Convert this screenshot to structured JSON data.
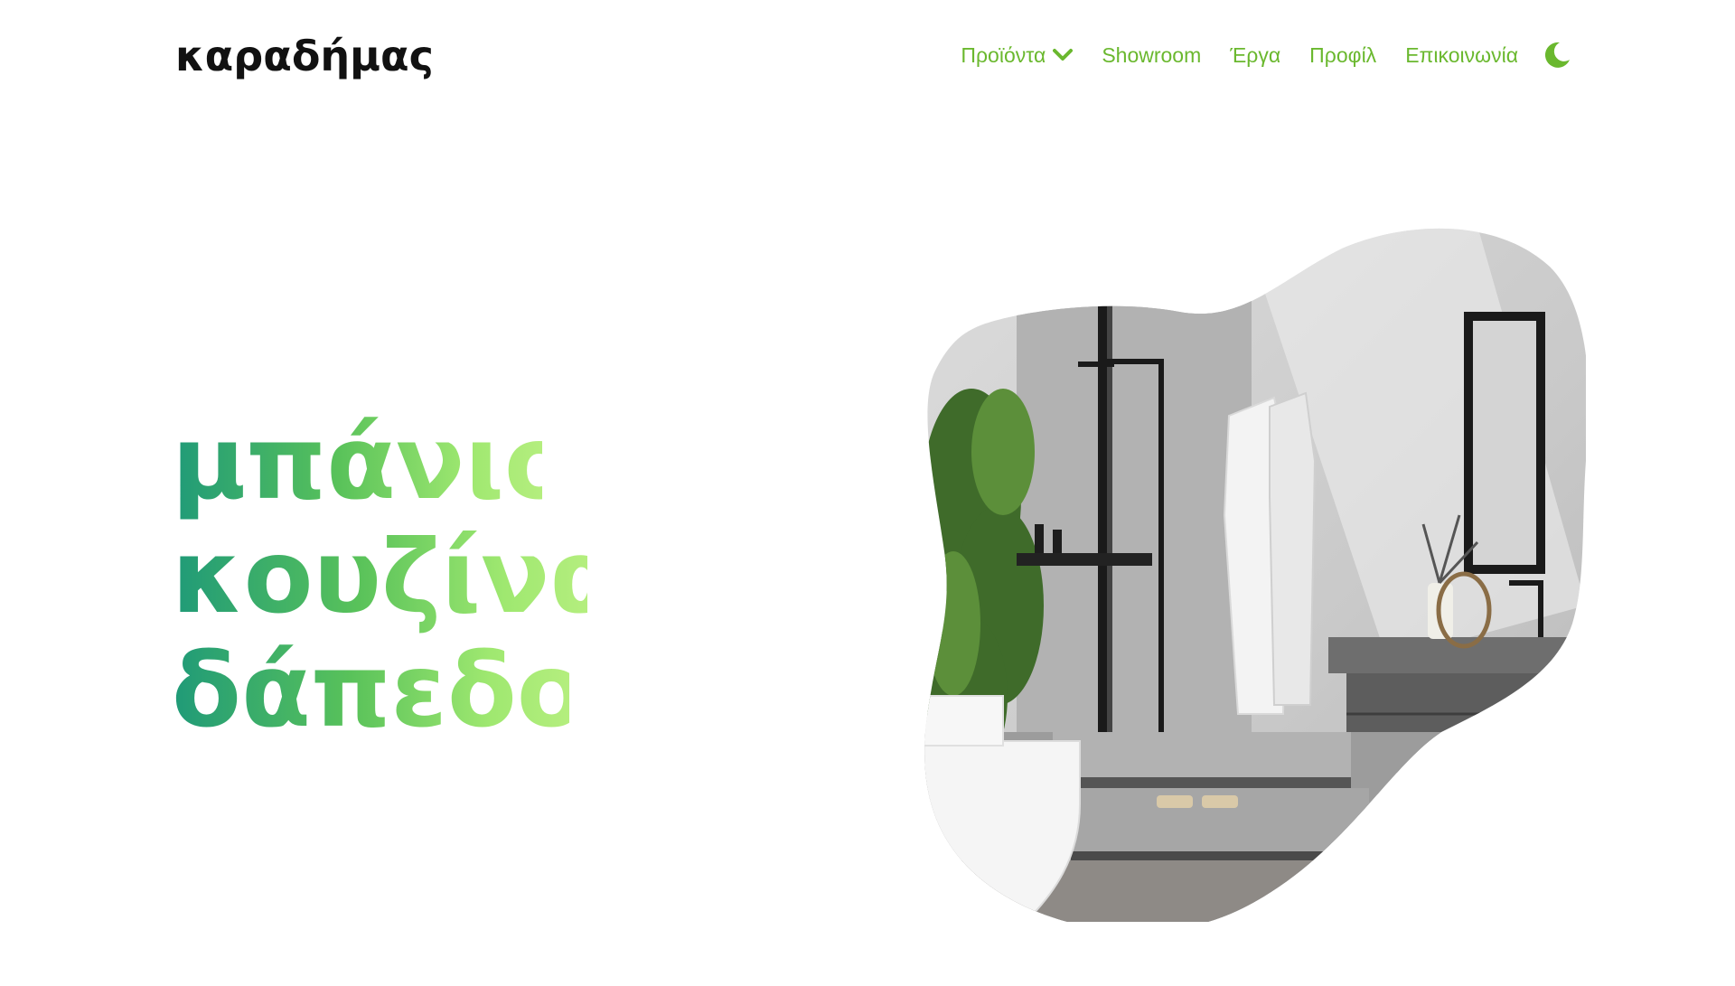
{
  "header": {
    "logo": "καραδήμας",
    "nav": [
      {
        "label": "Προϊόντα",
        "has_dropdown": true
      },
      {
        "label": "Showroom"
      },
      {
        "label": "Έργα"
      },
      {
        "label": "Προφίλ"
      },
      {
        "label": "Επικοινωνία"
      }
    ],
    "theme_toggle_icon": "moon-icon"
  },
  "hero": {
    "lines": [
      "μπάνιο",
      "κουζίνα",
      "δάπεδο"
    ]
  },
  "colors": {
    "accent": "#6ab82e",
    "gradient_start": "#1f9a78",
    "gradient_end": "#b4ee7e"
  }
}
